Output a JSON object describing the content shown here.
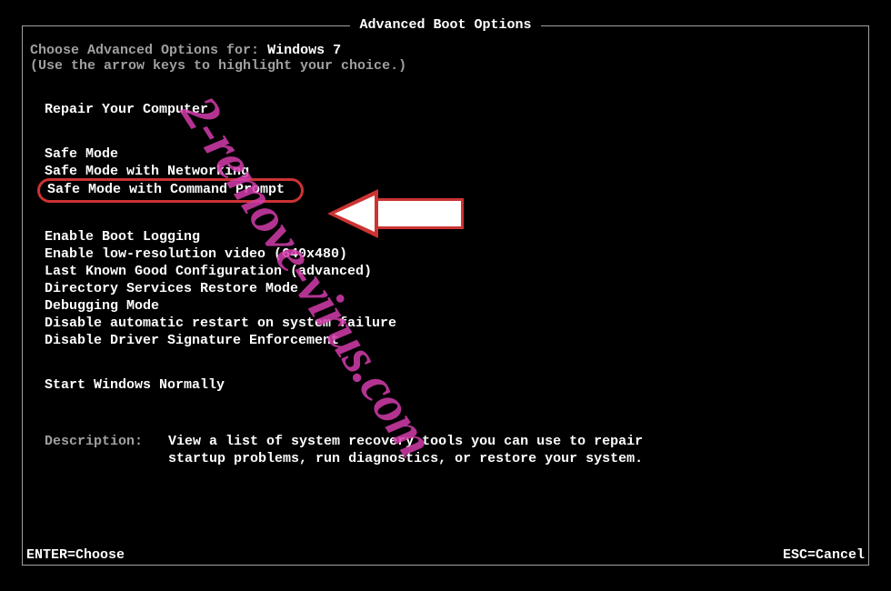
{
  "title": "Advanced Boot Options",
  "header": {
    "prompt_label": "Choose Advanced Options for:",
    "os_name": "Windows 7",
    "instruction": "(Use the arrow keys to highlight your choice.)"
  },
  "groups": [
    {
      "items": [
        {
          "label": "Repair Your Computer"
        }
      ]
    },
    {
      "items": [
        {
          "label": "Safe Mode"
        },
        {
          "label": "Safe Mode with Networking"
        },
        {
          "label": "Safe Mode with Command Prompt",
          "selected": true
        }
      ]
    },
    {
      "items": [
        {
          "label": "Enable Boot Logging"
        },
        {
          "label": "Enable low-resolution video (640x480)"
        },
        {
          "label": "Last Known Good Configuration (advanced)"
        },
        {
          "label": "Directory Services Restore Mode"
        },
        {
          "label": "Debugging Mode"
        },
        {
          "label": "Disable automatic restart on system failure"
        },
        {
          "label": "Disable Driver Signature Enforcement"
        }
      ]
    },
    {
      "items": [
        {
          "label": "Start Windows Normally"
        }
      ]
    }
  ],
  "description": {
    "label": "Description:",
    "text": "View a list of system recovery tools you can use to repair startup problems, run diagnostics, or restore your system."
  },
  "footer": {
    "enter": "ENTER=Choose",
    "esc": "ESC=Cancel"
  },
  "annotation": {
    "watermark": "2-remove-virus.com",
    "highlight_color": "#cc3333",
    "watermark_color": "rgba(210,60,170,0.85)"
  }
}
